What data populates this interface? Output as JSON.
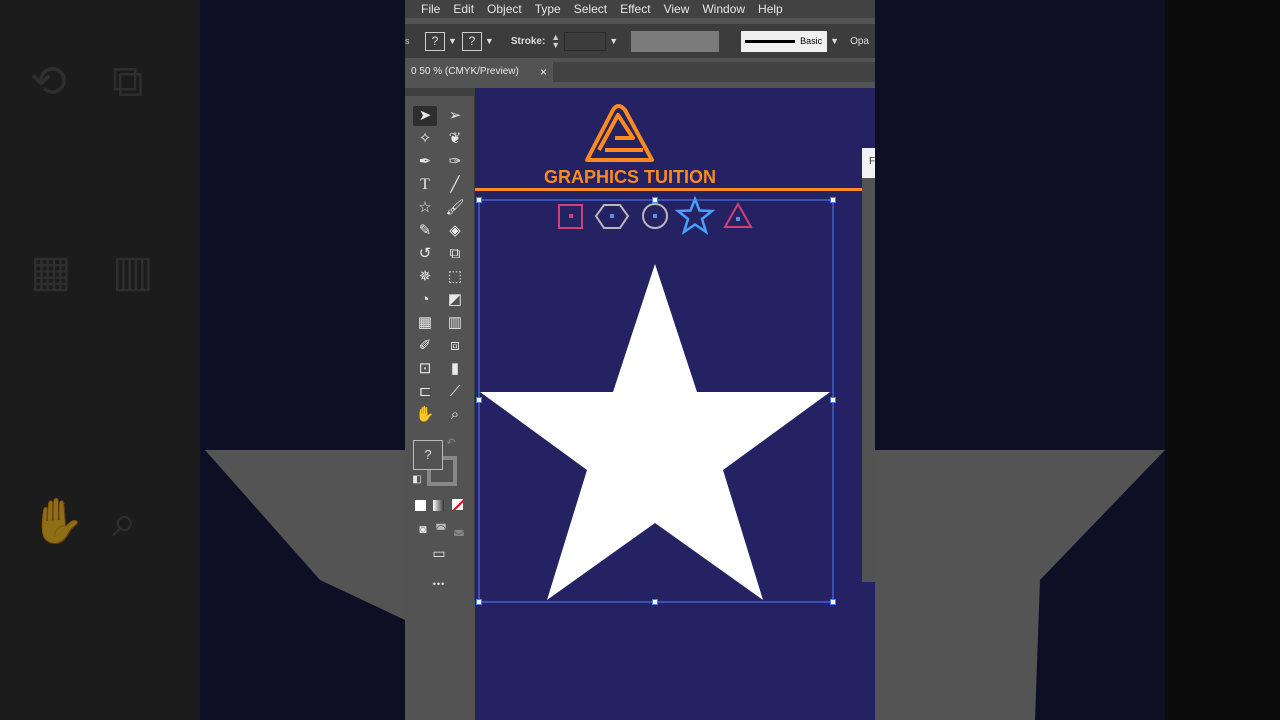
{
  "menu": [
    "File",
    "Edit",
    "Object",
    "Type",
    "Select",
    "Effect",
    "View",
    "Window",
    "Help"
  ],
  "control_bar": {
    "fill_glyph": "?",
    "stroke_glyph": "?",
    "stroke_label": "Stroke:",
    "stroke_style_label": "Basic",
    "opacity_label": "Opa"
  },
  "document_tab": {
    "title": "0 50 % (CMYK/Preview)",
    "close": "×"
  },
  "tools_panel": {
    "fill_stroke_glyph": "?",
    "more_tools": "•••"
  },
  "artboard": {
    "logo_text": "GRAPHICS TUITION",
    "brand_color": "#ff8a1e",
    "canvas_color": "#242263",
    "shape_icons": [
      "square-icon",
      "hexagon-icon",
      "circle-icon",
      "star-icon",
      "triangle-icon"
    ],
    "main_shape": "star-shape",
    "main_shape_color": "#ffffff"
  },
  "right_panel": {
    "tab_letter": "F"
  }
}
